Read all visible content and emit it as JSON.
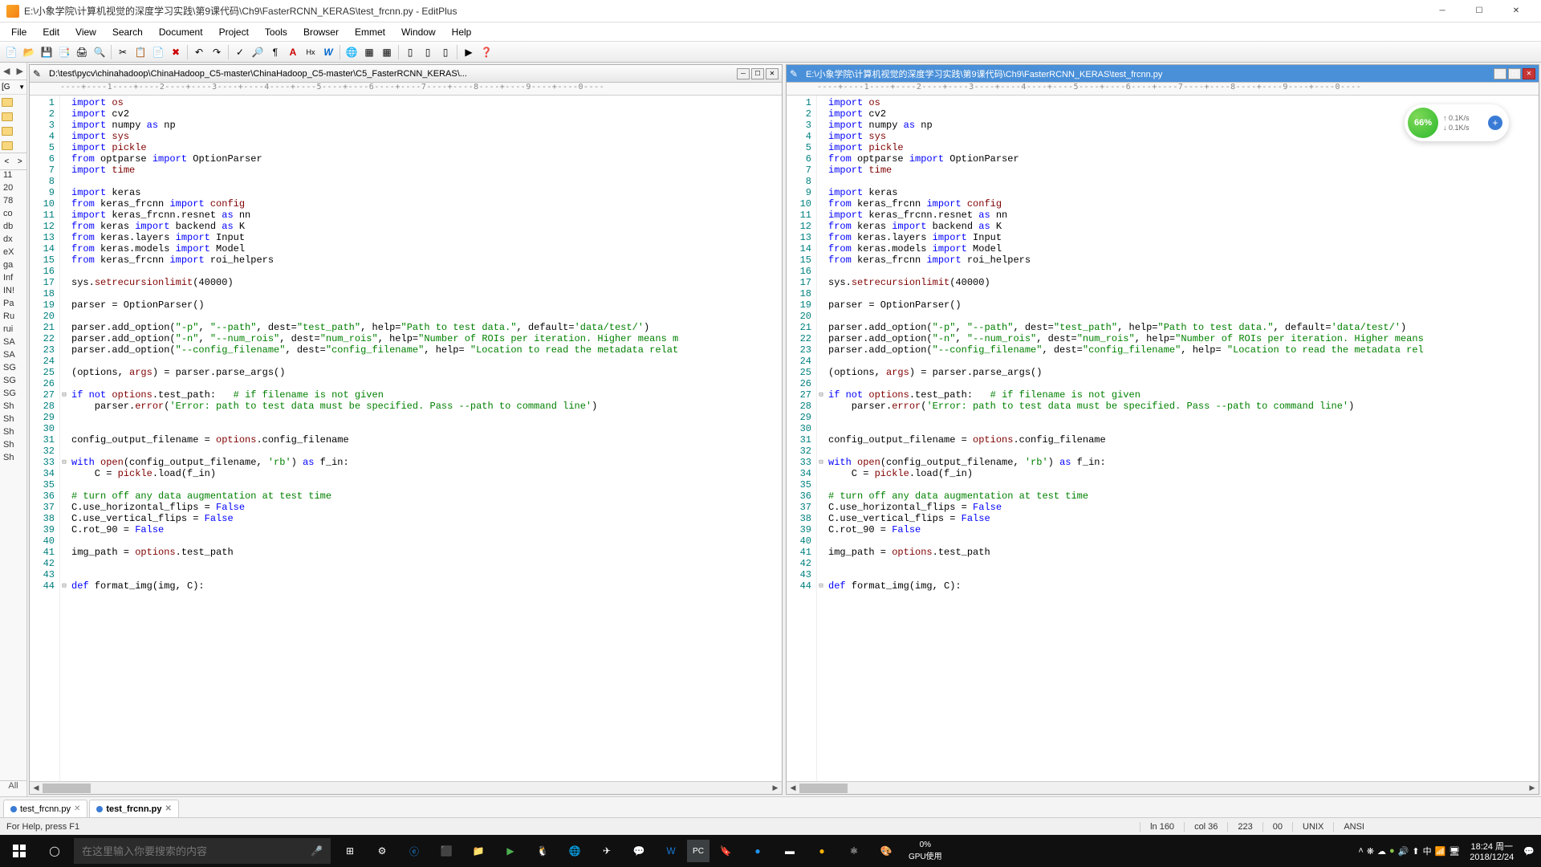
{
  "window": {
    "title": "E:\\小象学院\\计算机视觉的深度学习实践\\第9课代码\\Ch9\\FasterRCNN_KERAS\\test_frcnn.py - EditPlus"
  },
  "menu": [
    "File",
    "Edit",
    "View",
    "Search",
    "Document",
    "Project",
    "Tools",
    "Browser",
    "Emmet",
    "Window",
    "Help"
  ],
  "sidebar": {
    "top_label": "[G",
    "items": [
      "11",
      "20",
      "78",
      "co",
      "db",
      "dx",
      "eX",
      "ga",
      "Inf",
      "IN!",
      "Pa",
      "Ru",
      "rui",
      "SA",
      "SA",
      "SG",
      "SG",
      "SG",
      "Sh",
      "Sh",
      "Sh",
      "Sh",
      "Sh"
    ],
    "all": "All"
  },
  "pane_left": {
    "title": "D:\\test\\pycv\\chinahadoop\\ChinaHadoop_C5-master\\ChinaHadoop_C5-master\\C5_FasterRCNN_KERAS\\..."
  },
  "pane_right": {
    "title": "E:\\小象学院\\计算机视觉的深度学习实践\\第9课代码\\Ch9\\FasterRCNN_KERAS\\test_frcnn.py"
  },
  "ruler": "----+----1----+----2----+----3----+----4----+----5----+----6----+----7----+----8----+----9----+----0----",
  "code_lines": [
    {
      "n": 1,
      "h": "<span class='im'>import</span> <span class='fn'>os</span>"
    },
    {
      "n": 2,
      "h": "<span class='im'>import</span> cv2"
    },
    {
      "n": 3,
      "h": "<span class='im'>import</span> numpy <span class='im'>as</span> np"
    },
    {
      "n": 4,
      "h": "<span class='im'>import</span> <span class='fn'>sys</span>"
    },
    {
      "n": 5,
      "h": "<span class='im'>import</span> <span class='fn'>pickle</span>"
    },
    {
      "n": 6,
      "h": "<span class='im'>from</span> optparse <span class='im'>import</span> OptionParser"
    },
    {
      "n": 7,
      "h": "<span class='im'>import</span> <span class='fn'>time</span>"
    },
    {
      "n": 8,
      "h": ""
    },
    {
      "n": 9,
      "h": "<span class='im'>import</span> keras"
    },
    {
      "n": 10,
      "h": "<span class='im'>from</span> keras_frcnn <span class='im'>import</span> <span class='fn'>config</span>"
    },
    {
      "n": 11,
      "h": "<span class='im'>import</span> keras_frcnn.resnet <span class='im'>as</span> nn"
    },
    {
      "n": 12,
      "h": "<span class='im'>from</span> keras <span class='im'>import</span> backend <span class='im'>as</span> K"
    },
    {
      "n": 13,
      "h": "<span class='im'>from</span> keras.layers <span class='im'>import</span> Input"
    },
    {
      "n": 14,
      "h": "<span class='im'>from</span> keras.models <span class='im'>import</span> Model"
    },
    {
      "n": 15,
      "h": "<span class='im'>from</span> keras_frcnn <span class='im'>import</span> roi_helpers"
    },
    {
      "n": 16,
      "h": ""
    },
    {
      "n": 17,
      "h": "sys.<span class='cl'>setrecursionlimit</span>(40000)"
    },
    {
      "n": 18,
      "h": ""
    },
    {
      "n": 19,
      "h": "parser = OptionParser()"
    },
    {
      "n": 20,
      "h": ""
    },
    {
      "n": 21,
      "h": "parser.add_option(<span class='st'>\"-p\"</span>, <span class='st'>\"--path\"</span>, dest=<span class='st'>\"test_path\"</span>, help=<span class='st'>\"Path to test data.\"</span>, default=<span class='st'>'data/test/'</span>)"
    },
    {
      "n": 22,
      "h": "parser.add_option(<span class='st'>\"-n\"</span>, <span class='st'>\"--num_rois\"</span>, dest=<span class='st'>\"num_rois\"</span>, help=<span class='st'>\"Number of ROIs per iteration. Higher means m</span>"
    },
    {
      "n": 23,
      "h": "parser.add_option(<span class='st'>\"--config_filename\"</span>, dest=<span class='st'>\"config_filename\"</span>, help= <span class='st'>\"Location to read the metadata relat</span>"
    },
    {
      "n": 24,
      "h": ""
    },
    {
      "n": 25,
      "h": "(options, <span class='fn'>args</span>) = parser.parse_args()"
    },
    {
      "n": 26,
      "h": ""
    },
    {
      "n": 27,
      "h": "<span class='im'>if not</span> <span class='fn'>options</span>.test_path:   <span class='cm'># if filename is not given</span>",
      "fold": "⊟"
    },
    {
      "n": 28,
      "h": "    parser.<span class='cl'>error</span>(<span class='st'>'Error: path to test data must be specified. Pass --path to command line'</span>)"
    },
    {
      "n": 29,
      "h": ""
    },
    {
      "n": 30,
      "h": ""
    },
    {
      "n": 31,
      "h": "config_output_filename = <span class='fn'>options</span>.config_filename"
    },
    {
      "n": 32,
      "h": ""
    },
    {
      "n": 33,
      "h": "<span class='im'>with</span> <span class='cl'>open</span>(config_output_filename, <span class='st'>'rb'</span>) <span class='im'>as</span> f_in:",
      "fold": "⊟"
    },
    {
      "n": 34,
      "h": "    C = <span class='fn'>pickle</span>.load(f_in)"
    },
    {
      "n": 35,
      "h": ""
    },
    {
      "n": 36,
      "h": "<span class='cm'># turn off any data augmentation at test time</span>"
    },
    {
      "n": 37,
      "h": "C.use_horizontal_flips = <span class='im'>False</span>"
    },
    {
      "n": 38,
      "h": "C.use_vertical_flips = <span class='im'>False</span>"
    },
    {
      "n": 39,
      "h": "C.rot_90 = <span class='im'>False</span>"
    },
    {
      "n": 40,
      "h": ""
    },
    {
      "n": 41,
      "h": "img_path = <span class='fn'>options</span>.test_path"
    },
    {
      "n": 42,
      "h": ""
    },
    {
      "n": 43,
      "h": ""
    },
    {
      "n": 44,
      "h": "<span class='im'>def</span> format_img(img, C):",
      "fold": "⊟"
    }
  ],
  "code_lines_right": [
    {
      "n": 22,
      "h": "parser.add_option(<span class='st'>\"-n\"</span>, <span class='st'>\"--num_rois\"</span>, dest=<span class='st'>\"num_rois\"</span>, help=<span class='st'>\"Number of ROIs per iteration. Higher means</span>"
    },
    {
      "n": 23,
      "h": "parser.add_option(<span class='st'>\"--config_filename\"</span>, dest=<span class='st'>\"config_filename\"</span>, help= <span class='st'>\"Location to read the metadata rel</span>"
    }
  ],
  "file_tabs": [
    {
      "name": "test_frcnn.py",
      "active": false
    },
    {
      "name": "test_frcnn.py",
      "active": true
    }
  ],
  "status": {
    "help": "For Help, press F1",
    "ln": "ln 160",
    "col": "col 36",
    "c3": "223",
    "c4": "00",
    "c5": "UNIX",
    "c6": "ANSI"
  },
  "taskbar": {
    "search_placeholder": "在这里输入你要搜索的内容",
    "gpu_pct": "0%",
    "gpu_lbl": "GPU使用",
    "time": "18:24 周一",
    "date": "2018/12/24"
  },
  "widget": {
    "pct": "66%",
    "up": "0.1K/s",
    "down": "0.1K/s"
  }
}
